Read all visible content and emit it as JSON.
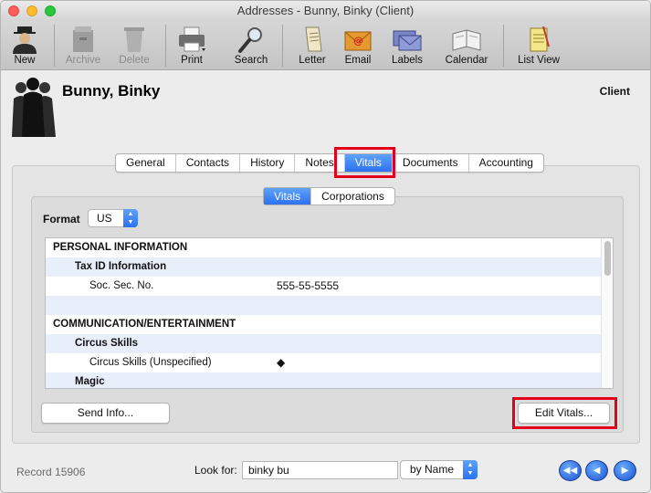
{
  "window": {
    "title": "Addresses - Bunny, Binky (Client)"
  },
  "toolbar": {
    "new": "New",
    "archive": "Archive",
    "delete": "Delete",
    "print": "Print",
    "search": "Search",
    "letter": "Letter",
    "email": "Email",
    "labels": "Labels",
    "calendar": "Calendar",
    "list_view": "List View"
  },
  "header": {
    "name": "Bunny, Binky",
    "type": "Client"
  },
  "tabs": [
    "General",
    "Contacts",
    "History",
    "Notes",
    "Vitals",
    "Documents",
    "Accounting"
  ],
  "active_tab": "Vitals",
  "subtabs": [
    "Vitals",
    "Corporations"
  ],
  "format": {
    "label": "Format",
    "value": "US"
  },
  "vitals_list": [
    {
      "type": "section",
      "key": "PERSONAL INFORMATION",
      "value": ""
    },
    {
      "type": "sub",
      "key": "Tax ID Information",
      "value": ""
    },
    {
      "type": "item",
      "key": "Soc. Sec. No.",
      "value": "555-55-5555"
    },
    {
      "type": "blank",
      "key": "",
      "value": ""
    },
    {
      "type": "section",
      "key": "COMMUNICATION/ENTERTAINMENT",
      "value": ""
    },
    {
      "type": "sub",
      "key": "Circus Skills",
      "value": ""
    },
    {
      "type": "item",
      "key": "Circus Skills (Unspecified)",
      "value": "◆"
    },
    {
      "type": "sub",
      "key": "Magic",
      "value": ""
    }
  ],
  "buttons": {
    "send_info": "Send Info...",
    "edit_vitals": "Edit Vitals..."
  },
  "footer": {
    "record": "Record 15906",
    "look_for_label": "Look for:",
    "look_for_value": "binky bu",
    "search_by": "by Name"
  },
  "colors": {
    "highlight": "#e4001b",
    "accent": "#2d71f0"
  }
}
